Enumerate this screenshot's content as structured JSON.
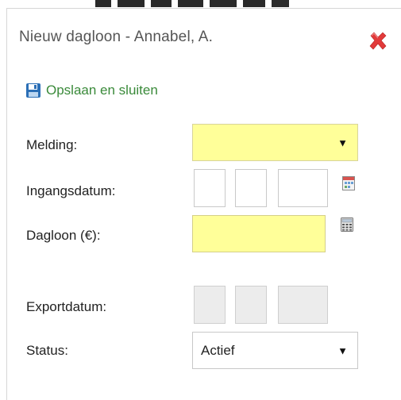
{
  "dialog": {
    "title": "Nieuw dagloon - Annabel, A.",
    "close_icon": "close-icon",
    "accent_close_color": "#e23a3a"
  },
  "toolbar": {
    "save_label": "Opslaan en sluiten",
    "save_icon": "floppy-disk-icon"
  },
  "form": {
    "melding": {
      "label": "Melding:",
      "value": "",
      "required_color": "#ffff99"
    },
    "ingangsdatum": {
      "label": "Ingangsdatum:",
      "day": "",
      "month": "",
      "year": "",
      "picker_icon": "calendar-icon"
    },
    "dagloon": {
      "label": "Dagloon (€):",
      "value": "",
      "calculator_icon": "calculator-icon"
    },
    "exportdatum": {
      "label": "Exportdatum:",
      "day": "",
      "month": "",
      "year": ""
    },
    "status": {
      "label": "Status:",
      "value": "Actief"
    }
  },
  "colors": {
    "save_text": "#3a8a3a",
    "required_field": "#ffff99",
    "disabled_field": "#ececec"
  }
}
